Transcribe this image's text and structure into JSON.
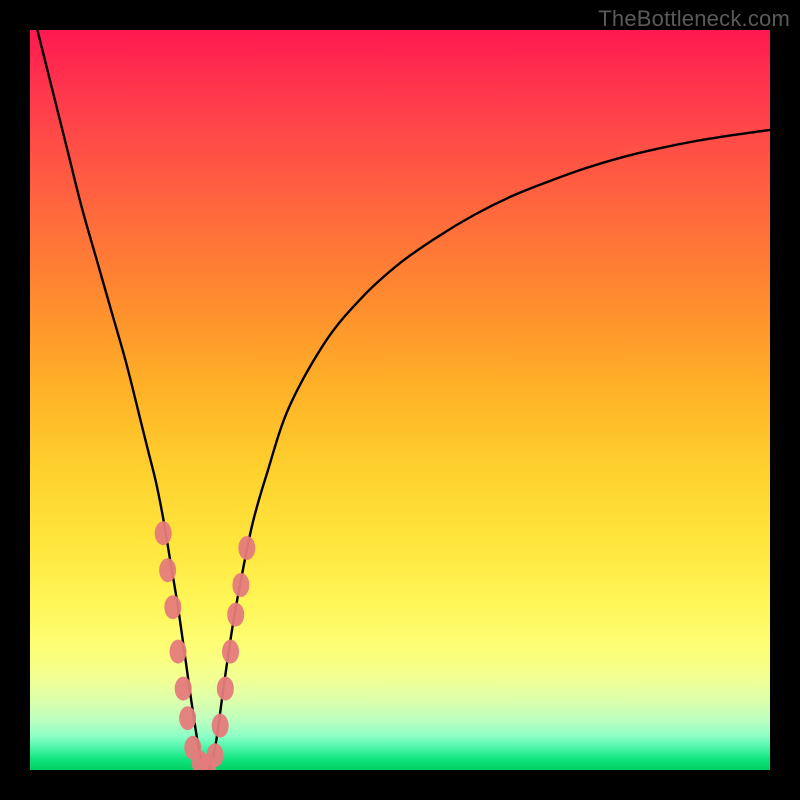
{
  "watermark": "TheBottleneck.com",
  "chart_data": {
    "type": "line",
    "title": "",
    "xlabel": "",
    "ylabel": "",
    "xlim": [
      0,
      100
    ],
    "ylim": [
      0,
      100
    ],
    "grid": false,
    "legend": false,
    "series": [
      {
        "name": "curve",
        "color": "#000000",
        "x": [
          1,
          3,
          5,
          7,
          9,
          11,
          13,
          15,
          16,
          17,
          18,
          19,
          20,
          21,
          22,
          23,
          24,
          25,
          26,
          27,
          28,
          30,
          32,
          35,
          40,
          45,
          50,
          55,
          60,
          65,
          70,
          75,
          80,
          85,
          90,
          95,
          100
        ],
        "values": [
          100,
          92,
          84,
          76,
          69,
          62,
          55,
          47,
          43,
          39,
          34,
          28,
          22,
          15,
          8,
          2,
          0,
          3,
          10,
          17,
          23,
          33,
          40,
          49,
          58,
          64,
          68.5,
          72,
          75,
          77.5,
          79.5,
          81.3,
          82.8,
          84,
          85,
          85.8,
          86.5
        ]
      },
      {
        "name": "marker-clusters",
        "color": "#e57b7b",
        "note": "approximate positions of pink bead markers along the valley",
        "points": [
          {
            "x": 18.0,
            "y": 32
          },
          {
            "x": 18.6,
            "y": 27
          },
          {
            "x": 19.3,
            "y": 22
          },
          {
            "x": 20.0,
            "y": 16
          },
          {
            "x": 20.7,
            "y": 11
          },
          {
            "x": 21.3,
            "y": 7
          },
          {
            "x": 22.0,
            "y": 3
          },
          {
            "x": 23.0,
            "y": 1
          },
          {
            "x": 24.0,
            "y": 0.5
          },
          {
            "x": 25.0,
            "y": 2
          },
          {
            "x": 25.7,
            "y": 6
          },
          {
            "x": 26.4,
            "y": 11
          },
          {
            "x": 27.1,
            "y": 16
          },
          {
            "x": 27.8,
            "y": 21
          },
          {
            "x": 28.5,
            "y": 25
          },
          {
            "x": 29.3,
            "y": 30
          }
        ]
      }
    ]
  }
}
